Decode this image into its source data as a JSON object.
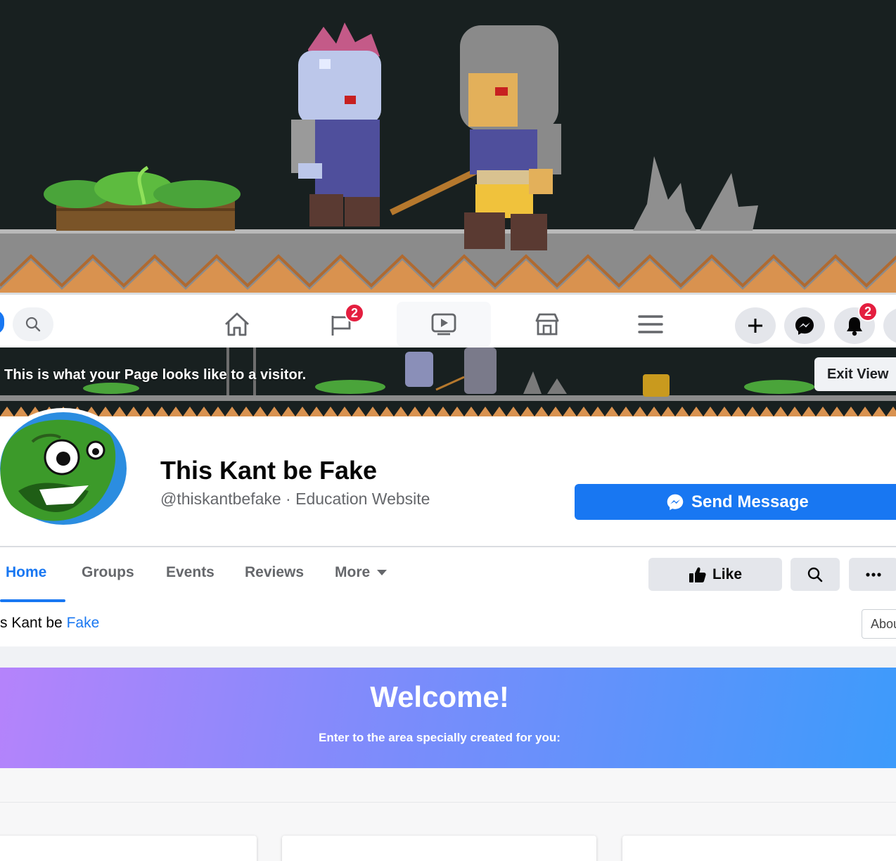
{
  "colors": {
    "accent": "#1877f2",
    "badge": "#e41e3f",
    "banner_start": "#b583fb",
    "banner_end": "#3d9bfb"
  },
  "topnav": {
    "search_icon": "search-icon",
    "tabs": [
      {
        "icon": "home-icon",
        "badge": ""
      },
      {
        "icon": "flag-icon",
        "badge": "2"
      },
      {
        "icon": "watch-icon",
        "badge": ""
      },
      {
        "icon": "marketplace-icon",
        "badge": ""
      },
      {
        "icon": "menu-icon",
        "badge": ""
      }
    ],
    "notifications_badge": "2"
  },
  "visitor_strip": {
    "message": "This is what your Page looks like to a visitor.",
    "exit_label": "Exit View"
  },
  "profile": {
    "name": "This Kant be Fake",
    "subtitle": "@thiskantbefake · Education Website",
    "send_message_label": "Send Message",
    "tabs": [
      "Home",
      "Groups",
      "Events",
      "Reviews",
      "More"
    ],
    "like_label": "Like",
    "breadcrumb_prefix": "s Kant be ",
    "breadcrumb_highlight": "Fake",
    "about_label": "Abou"
  },
  "welcome": {
    "title": "Welcome!",
    "subtitle": "Enter to the area specially created for you:"
  }
}
